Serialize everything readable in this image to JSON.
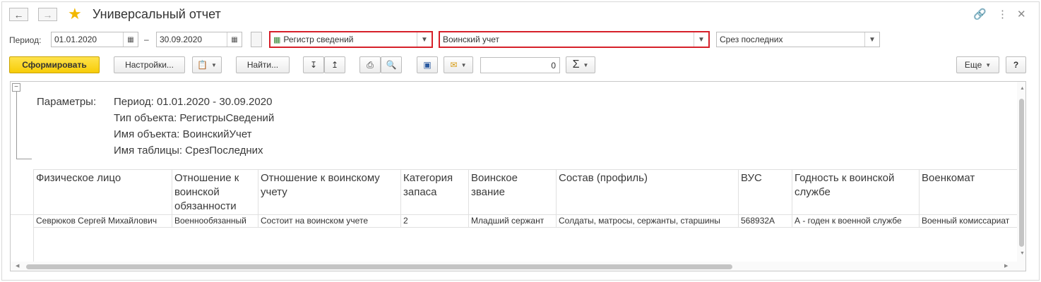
{
  "window": {
    "title": "Универсальный отчет",
    "back_icon": "arrow-left",
    "forward_icon": "arrow-right",
    "link_icon": "link",
    "more_icon": "vertical-dots",
    "close_icon": "close"
  },
  "form": {
    "period_label": "Период:",
    "date_from": "01.01.2020",
    "dash": "–",
    "date_to": "30.09.2020",
    "object_type": "Регистр сведений",
    "object_name": "Воинский учет",
    "table_name": "Срез последних"
  },
  "toolbar": {
    "generate": "Сформировать",
    "settings": "Настройки...",
    "find": "Найти...",
    "number_value": "0",
    "more": "Еще",
    "help": "?"
  },
  "report": {
    "params_label": "Параметры:",
    "params": [
      "Период: 01.01.2020 - 30.09.2020",
      "Тип объекта: РегистрыСведений",
      "Имя объекта: ВоинскийУчет",
      "Имя таблицы: СрезПоследних"
    ],
    "columns": [
      [
        "Физическое лицо"
      ],
      [
        "Отношение к",
        "воинской",
        "обязанности"
      ],
      [
        "Отношение к воинскому",
        "учету"
      ],
      [
        "Категория",
        "запаса"
      ],
      [
        "Воинское",
        "звание"
      ],
      [
        "Состав (профиль)"
      ],
      [
        "ВУС"
      ],
      [
        "Годность к воинской",
        "службе"
      ],
      [
        "Военкомат"
      ]
    ],
    "rows": [
      [
        "Севрюков Сергей Михайлович",
        "Военнообязанный",
        "Состоит на воинском учете",
        "2",
        "Младший сержант",
        "Солдаты, матросы, сержанты, старшины",
        "568932А",
        "А - годен к военной службе",
        "Военный комиссариат"
      ]
    ]
  },
  "colors": {
    "accent_yellow": "#f7cc07",
    "highlight_red": "#d6202a",
    "star": "#f2b800"
  }
}
